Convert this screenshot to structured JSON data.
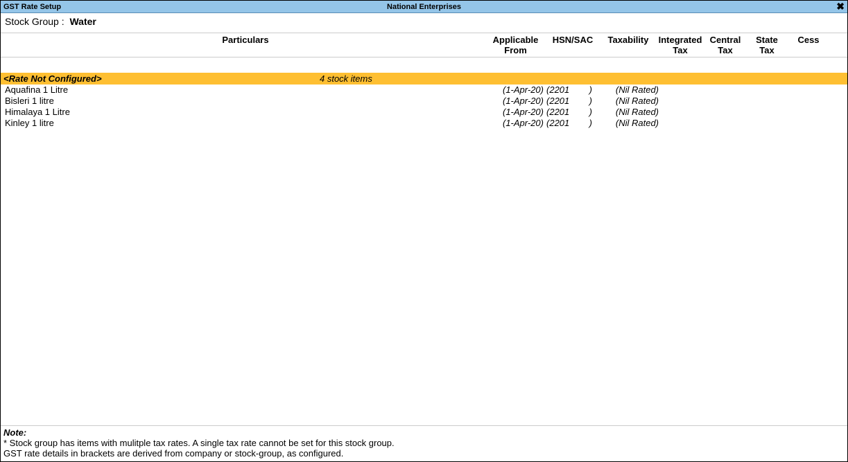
{
  "titlebar": {
    "left": "GST Rate Setup",
    "center": "National Enterprises"
  },
  "stock_group": {
    "label": "Stock Group :",
    "value": "Water"
  },
  "columns": {
    "particulars": "Particulars",
    "applicable_from_l1": "Applicable",
    "applicable_from_l2": "From",
    "hsn_sac": "HSN/SAC",
    "taxability": "Taxability",
    "integrated_l1": "Integrated",
    "integrated_l2": "Tax",
    "central_l1": "Central",
    "central_l2": "Tax",
    "state_l1": "State",
    "state_l2": "Tax",
    "cess": "Cess"
  },
  "group": {
    "title": "<Rate Not Configured>",
    "count_text": "4 stock items"
  },
  "rows": [
    {
      "name": "Aquafina 1 Litre",
      "applicable": "(1-Apr-20)",
      "hsn": "2201",
      "taxability": "(Nil Rated)"
    },
    {
      "name": "Bisleri 1 litre",
      "applicable": "(1-Apr-20)",
      "hsn": "2201",
      "taxability": "(Nil Rated)"
    },
    {
      "name": "Himalaya 1 Litre",
      "applicable": "(1-Apr-20)",
      "hsn": "2201",
      "taxability": "(Nil Rated)"
    },
    {
      "name": "Kinley 1 litre",
      "applicable": "(1-Apr-20)",
      "hsn": "2201",
      "taxability": "(Nil Rated)"
    }
  ],
  "note": {
    "title": "Note:",
    "line1": "* Stock group has items with mulitple tax rates. A single tax rate cannot be set for this stock group.",
    "line2": "GST rate details in brackets are derived from company or stock-group, as configured."
  },
  "brackets": {
    "open": "(",
    "close": ")"
  }
}
